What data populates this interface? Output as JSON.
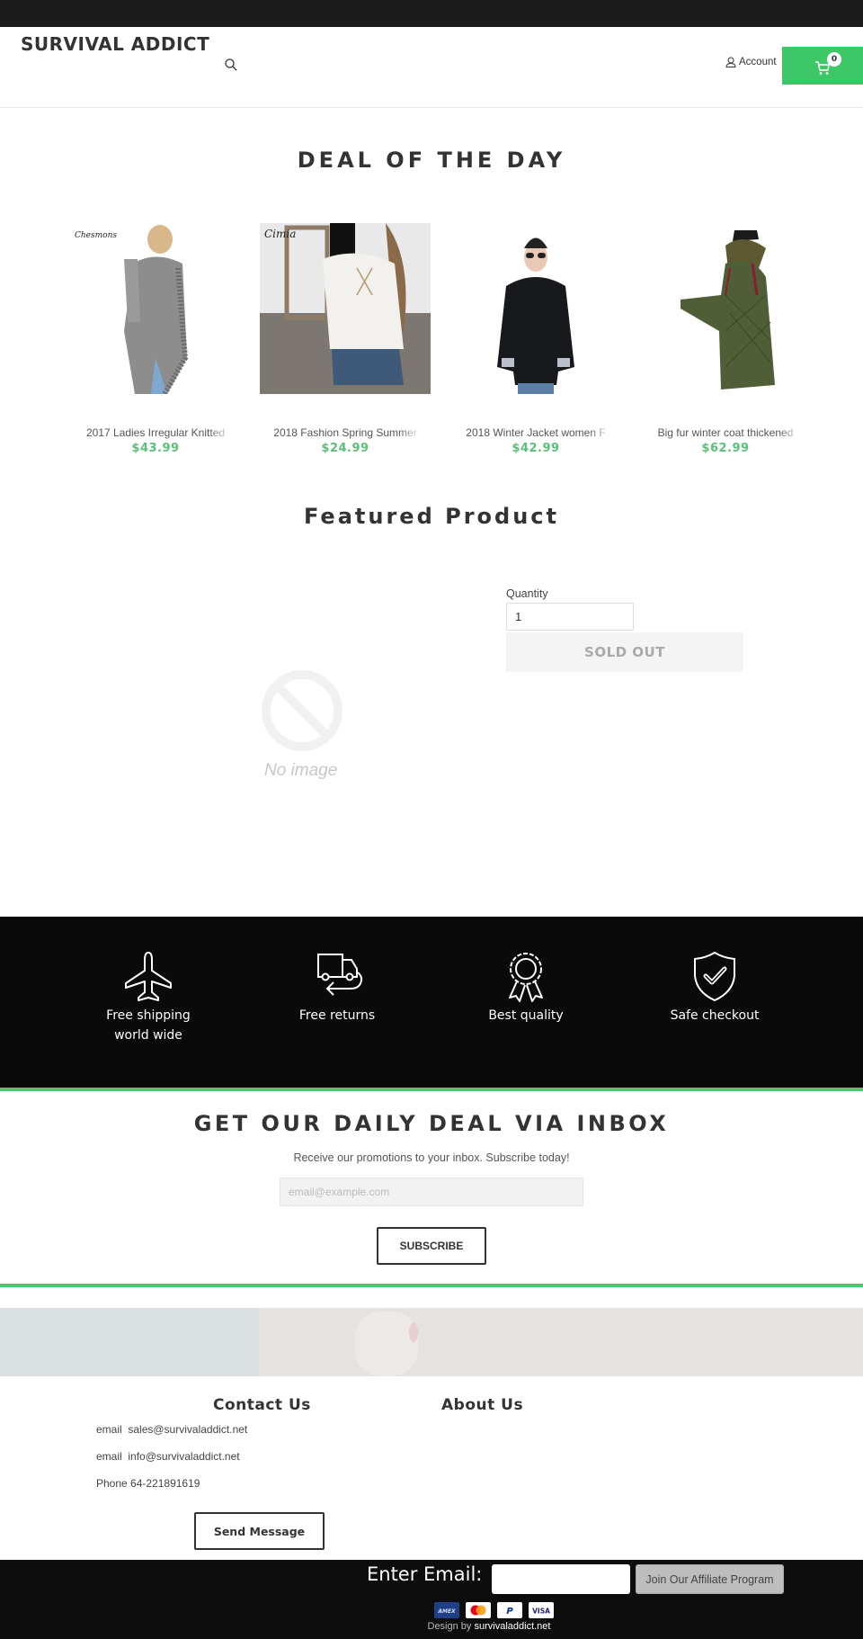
{
  "header": {
    "logo": "SURVIVAL ADDICT",
    "account_label": "Account",
    "cart_count": "0",
    "brand_color": "#3ec766"
  },
  "deal_of_the_day": {
    "title": "DEAL OF THE DAY",
    "products": [
      {
        "name": "2017 Ladies Irregular Knitted",
        "price": "$43.99",
        "image": "grey fringed knit cardigan, Chesmons logo"
      },
      {
        "name": "2018 Fashion Spring Summer",
        "price": "$24.99",
        "image": "white lace-up blouse with denim shorts, Cimia logo"
      },
      {
        "name": "2018 Winter Jacket women F",
        "price": "$42.99",
        "image": "black short puffer jacket"
      },
      {
        "name": "Big fur winter coat thickened",
        "price": "$62.99",
        "image": "long olive-green quilted coat with fur hood"
      }
    ]
  },
  "featured_product": {
    "title": "Featured Product",
    "no_image_label": "No image",
    "quantity_label": "Quantity",
    "quantity_value": "1",
    "sold_out_label": "SOLD OUT"
  },
  "features": [
    {
      "icon": "airplane-icon",
      "label_line1": "Free shipping",
      "label_line2": "world wide"
    },
    {
      "icon": "truck-return-icon",
      "label_line1": "Free returns",
      "label_line2": ""
    },
    {
      "icon": "award-ribbon-icon",
      "label_line1": "Best quality",
      "label_line2": ""
    },
    {
      "icon": "shield-check-icon",
      "label_line1": "Safe checkout",
      "label_line2": ""
    }
  ],
  "newsletter": {
    "title": "GET OUR DAILY DEAL VIA INBOX",
    "subtitle": "Receive our promotions to your inbox. Subscribe today!",
    "email_placeholder": "email@example.com",
    "subscribe_label": "SUBSCRIBE"
  },
  "footer": {
    "contact_title": "Contact Us",
    "about_title": "About Us",
    "contacts": [
      {
        "label": "email",
        "value": "sales@survivaladdict.net"
      },
      {
        "label": "email",
        "value": "info@survivaladdict.net"
      },
      {
        "label": "Phone",
        "value": "64-221891619"
      }
    ],
    "send_message_label": "Send Message",
    "enter_email_label": "Enter Email:",
    "affiliate_button_label": "Join Our Affiliate Program",
    "payment_methods": [
      "AMEX",
      "Mastercard",
      "PayPal",
      "VISA"
    ],
    "credit_prefix": "Design by",
    "credit_link": "survivaladdict.net"
  }
}
